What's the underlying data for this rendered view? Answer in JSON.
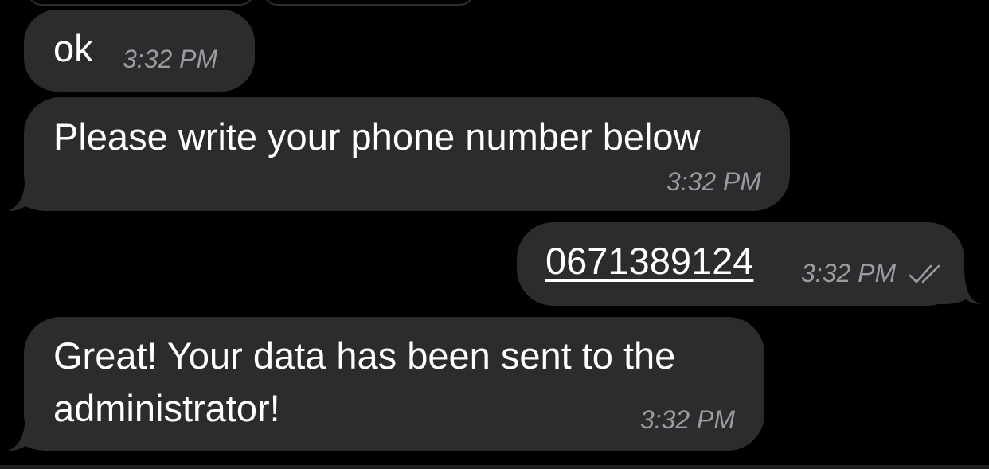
{
  "messages": [
    {
      "direction": "incoming",
      "text": "ok",
      "time": "3:32 PM"
    },
    {
      "direction": "incoming",
      "text": "Please write your phone number below",
      "time": "3:32 PM"
    },
    {
      "direction": "outgoing",
      "text": "0671389124",
      "time": "3:32 PM",
      "status": "read",
      "status_icon": "double-check-icon"
    },
    {
      "direction": "incoming",
      "text_lines": [
        "Great! Your data has been sent to the",
        "administrator!"
      ],
      "time": "3:32 PM"
    }
  ],
  "colors": {
    "background": "#000000",
    "bubble": "#2c2c2e",
    "text": "#ffffff",
    "timestamp": "#9b9ba0"
  }
}
